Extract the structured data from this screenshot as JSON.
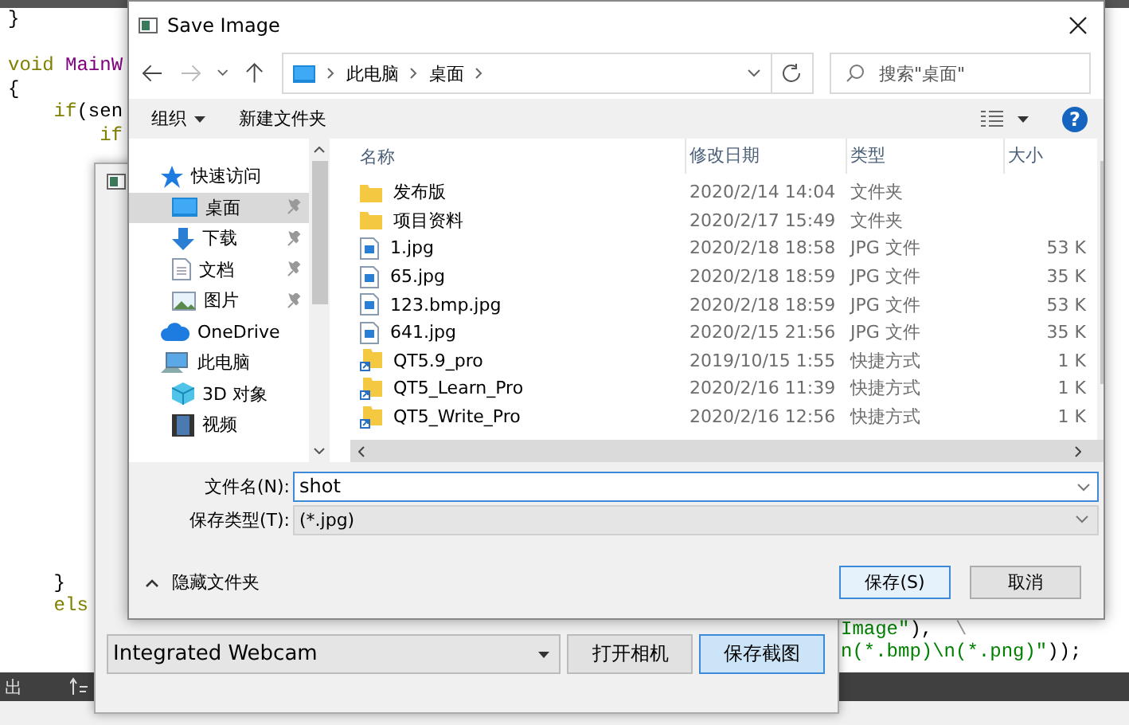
{
  "editor": {
    "top_lines": [
      [
        {
          "text": "}",
          "kind": "plain"
        }
      ],
      [
        {
          "text": "void ",
          "kind": "keyword"
        },
        {
          "text": "MainW",
          "kind": "name"
        }
      ],
      [
        {
          "text": "{",
          "kind": "plain"
        }
      ],
      [
        {
          "text": "    if",
          "kind": "keyword"
        },
        {
          "text": "(sen",
          "kind": "plain"
        }
      ],
      [
        {
          "text": "        if",
          "kind": "keyword"
        }
      ]
    ],
    "bottom_lines": [
      [
        {
          "text": "    }",
          "kind": "plain"
        }
      ],
      [
        {
          "text": "    els",
          "kind": "keyword"
        }
      ]
    ],
    "right_lines": [
      [
        {
          "text": "Image\"",
          "kind": "string"
        },
        {
          "text": "),",
          "kind": "plain"
        },
        {
          "text": "  \\",
          "kind": "comment"
        }
      ],
      [
        {
          "text": "n(*.bmp)\\n(*.png)\"",
          "kind": "string"
        },
        {
          "text": "));",
          "kind": "plain"
        }
      ]
    ],
    "status_bar": {
      "label": "出"
    }
  },
  "camera_window": {
    "camera_select": {
      "value": "Integrated Webcam"
    },
    "buttons": [
      {
        "label": "打开相机",
        "focused": false
      },
      {
        "label": "保存截图",
        "focused": true
      }
    ]
  },
  "dialog": {
    "title": "Save Image",
    "address": {
      "crumbs": [
        "此电脑",
        "桌面"
      ]
    },
    "search": {
      "placeholder": "搜索\"桌面\""
    },
    "toolbar": {
      "organize": "组织",
      "new_folder": "新建文件夹",
      "help": "?"
    },
    "nav": [
      {
        "label": "快速访问",
        "kind": "star",
        "children": [
          {
            "label": "桌面",
            "kind": "desktop",
            "selected": true,
            "pinned": true
          },
          {
            "label": "下载",
            "kind": "download",
            "selected": false,
            "pinned": true
          },
          {
            "label": "文档",
            "kind": "document",
            "selected": false,
            "pinned": true
          },
          {
            "label": "图片",
            "kind": "picture",
            "selected": false,
            "pinned": true
          }
        ]
      },
      {
        "label": "OneDrive",
        "kind": "cloud"
      },
      {
        "label": "此电脑",
        "kind": "computer",
        "children": [
          {
            "label": "3D 对象",
            "kind": "cube",
            "selected": false,
            "pinned": false
          },
          {
            "label": "视频",
            "kind": "video",
            "selected": false,
            "pinned": false
          }
        ]
      }
    ],
    "columns": [
      "名称",
      "修改日期",
      "类型",
      "大小"
    ],
    "files": [
      {
        "name": "发布版",
        "date": "2020/2/14 14:04",
        "type": "文件夹",
        "kind": "folder"
      },
      {
        "name": "项目资料",
        "date": "2020/2/17 15:49",
        "type": "文件夹",
        "kind": "folder"
      },
      {
        "name": "1.jpg",
        "date": "2020/2/18 18:58",
        "type": "JPG 文件",
        "size": "53 K",
        "kind": "image"
      },
      {
        "name": "65.jpg",
        "date": "2020/2/18 18:59",
        "type": "JPG 文件",
        "size": "35 K",
        "kind": "image"
      },
      {
        "name": "123.bmp.jpg",
        "date": "2020/2/18 18:59",
        "type": "JPG 文件",
        "size": "53 K",
        "kind": "image"
      },
      {
        "name": "641.jpg",
        "date": "2020/2/15 21:56",
        "type": "JPG 文件",
        "size": "35 K",
        "kind": "image"
      },
      {
        "name": "QT5.9_pro",
        "date": "2019/10/15 1:55",
        "type": "快捷方式",
        "size": "1 K",
        "kind": "shortcut"
      },
      {
        "name": "QT5_Learn_Pro",
        "date": "2020/2/16 11:39",
        "type": "快捷方式",
        "size": "1 K",
        "kind": "shortcut"
      },
      {
        "name": "QT5_Write_Pro",
        "date": "2020/2/16 12:56",
        "type": "快捷方式",
        "size": "1 K",
        "kind": "shortcut"
      }
    ],
    "file_name": {
      "label": "文件名(N):",
      "value": "shot"
    },
    "file_type": {
      "label": "保存类型(T):",
      "value": "(*.jpg)"
    },
    "hide_folders": "隐藏文件夹",
    "buttons": [
      {
        "label": "保存(S)",
        "kind": "primary"
      },
      {
        "label": "取消",
        "kind": "normal"
      }
    ]
  }
}
